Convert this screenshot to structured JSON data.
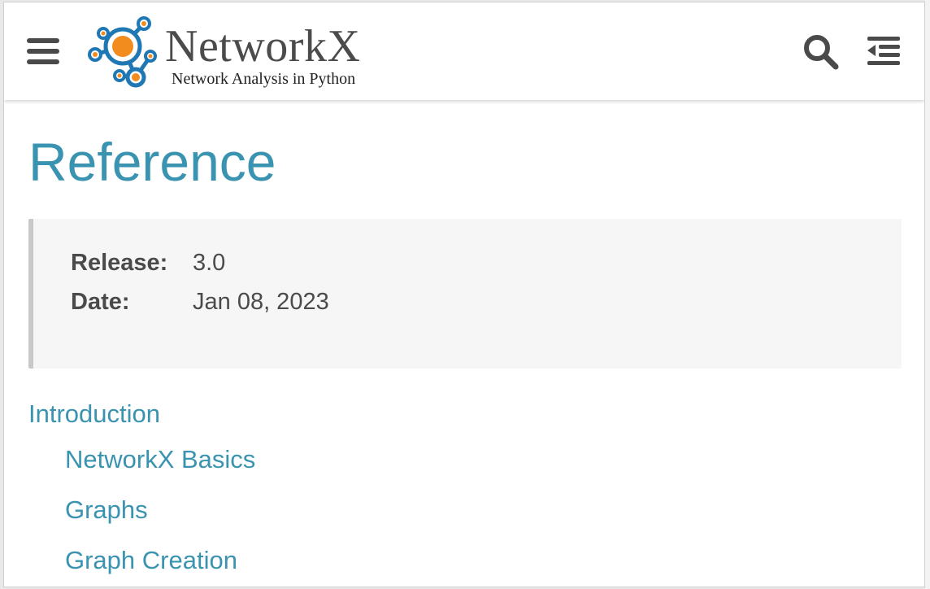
{
  "header": {
    "logo_name": "NetworkX",
    "logo_tagline": "Network Analysis in Python",
    "icons": {
      "menu": "hamburger-menu-icon",
      "search": "search-icon",
      "toc": "table-of-contents-icon"
    }
  },
  "page": {
    "title": "Reference"
  },
  "meta": {
    "release_label": "Release:",
    "release_value": "3.0",
    "date_label": "Date:",
    "date_value": "Jan 08, 2023"
  },
  "toc": {
    "items": [
      {
        "label": "Introduction",
        "level": 1
      },
      {
        "label": "NetworkX Basics",
        "level": 2
      },
      {
        "label": "Graphs",
        "level": 2
      },
      {
        "label": "Graph Creation",
        "level": 2
      }
    ]
  },
  "colors": {
    "accent": "#3a93b0",
    "logo_orange": "#f28c1e",
    "logo_blue": "#1f77b4",
    "icon_gray": "#4a4a4a",
    "meta_bg": "#f6f6f6"
  }
}
